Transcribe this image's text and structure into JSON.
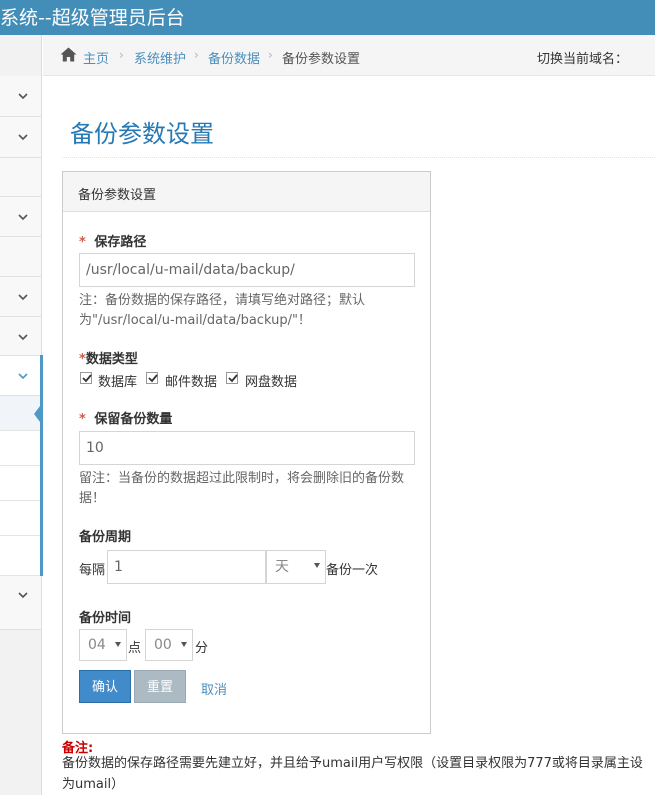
{
  "app": {
    "title": "系统--超级管理员后台"
  },
  "breadcrumb": {
    "home": "主页",
    "items": [
      "系统维护",
      "备份数据"
    ],
    "current": "备份参数设置",
    "separator": "›"
  },
  "header": {
    "domain_switch": "切换当前域名："
  },
  "page": {
    "title": "备份参数设置"
  },
  "panel": {
    "title": "备份参数设置"
  },
  "form": {
    "required_mark": "*",
    "path": {
      "label": "保存路径",
      "value": "/usr/local/u-mail/data/backup/",
      "note": "注：备份数据的保存路径，请填写绝对路径；默认为\"/usr/local/u-mail/data/backup/\"！"
    },
    "data_type": {
      "label": "数据类型",
      "options": [
        {
          "label": "数据库",
          "checked": true
        },
        {
          "label": "邮件数据",
          "checked": true
        },
        {
          "label": "网盘数据",
          "checked": true
        }
      ]
    },
    "keep_count": {
      "label": "保留备份数量",
      "value": "10",
      "note": "留注：当备份的数据超过此限制时，将会删除旧的备份数据！"
    },
    "cycle": {
      "label": "备份周期",
      "prefix": "每隔",
      "value": "1",
      "unit": "天",
      "suffix": "备份一次"
    },
    "time": {
      "label": "备份时间",
      "hour": "04",
      "hour_unit": "点",
      "minute": "00",
      "minute_unit": "分"
    }
  },
  "buttons": {
    "confirm": "确认",
    "reset": "重置",
    "cancel": "取消"
  },
  "footnote": {
    "title": "备注:",
    "text": "备份数据的保存路径需要先建立好，并且给予umail用户写权限（设置目录权限为777或将目录属主设为umail）"
  },
  "colors": {
    "topbar": "#438eb9",
    "link": "#4c8fbd",
    "title": "#2679b5",
    "primary_button": "#428bca",
    "required": "#d15b47"
  },
  "icons": {
    "home": "home-icon",
    "sidebar_toggle": "chevron-down-icon",
    "checkbox": "check-icon"
  }
}
